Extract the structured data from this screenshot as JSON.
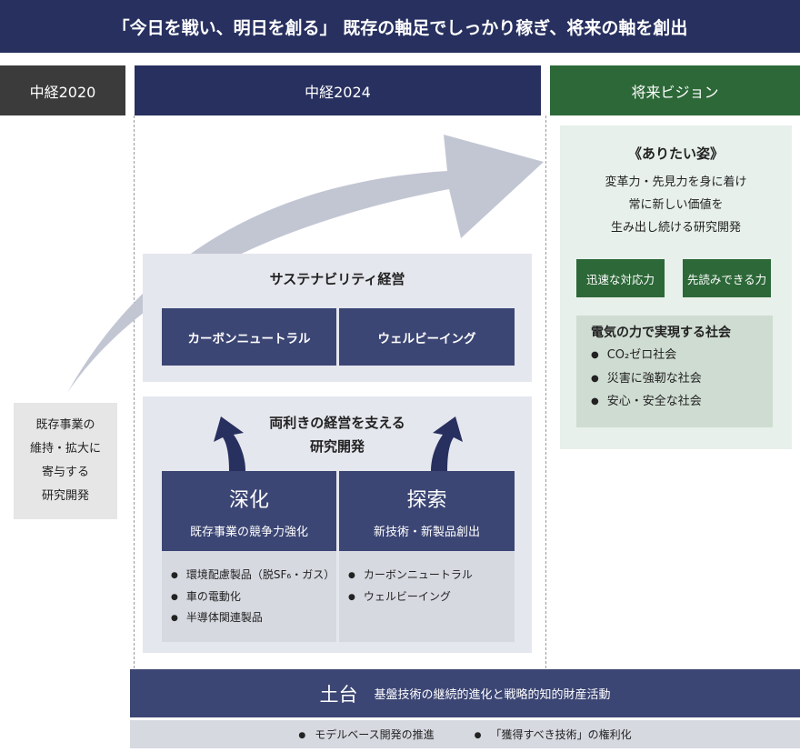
{
  "banner": {
    "title": "「今日を戦い、明日を創る」 既存の軸足でしっかり稼ぎ、将来の軸を創出"
  },
  "columns": {
    "plan2020": "中経2020",
    "plan2024": "中経2024",
    "vision": "将来ビジョン"
  },
  "existing": {
    "line1": "既存事業の",
    "line2": "維持・拡大に",
    "line3": "寄与する",
    "line4": "研究開発"
  },
  "sustainability": {
    "title": "サステナビリティ経営",
    "carbon_neutral": "カーボンニュートラル",
    "wellbeing": "ウェルビーイング"
  },
  "ambidextrous": {
    "title_line1": "両利きの経営を支える",
    "title_line2": "研究開発",
    "deepening": {
      "title": "深化",
      "subtitle": "既存事業の競争力強化",
      "items": [
        "環境配慮製品（脱SF₆・ガス）",
        "車の電動化",
        "半導体関連製品"
      ]
    },
    "exploration": {
      "title": "探索",
      "subtitle": "新技術・新製品創出",
      "items": [
        "カーボンニュートラル",
        "ウェルビーイング"
      ]
    }
  },
  "vision": {
    "title": "《ありたい姿》",
    "desc_line1": "変革力・先見力を身に着け",
    "desc_line2": "常に新しい価値を",
    "desc_line3": "生み出し続ける研究開発",
    "agility": "迅速な対応力",
    "foresight": "先読みできる力",
    "society": {
      "title": "電気の力で実現する社会",
      "items": [
        "CO₂ゼロ社会",
        "災害に強靭な社会",
        "安心・安全な社会"
      ]
    }
  },
  "foundation": {
    "title": "土台",
    "desc": "基盤技術の継続的進化と戦略的知的財産活動",
    "items": [
      "モデルベース開発の推進",
      "「獲得すべき技術」の権利化"
    ]
  },
  "colors": {
    "navy": "#27305f",
    "panel_navy": "#3c4674",
    "green": "#2d6838",
    "dark_gray": "#3b3b3b",
    "arrow": "#c2c6d3"
  }
}
